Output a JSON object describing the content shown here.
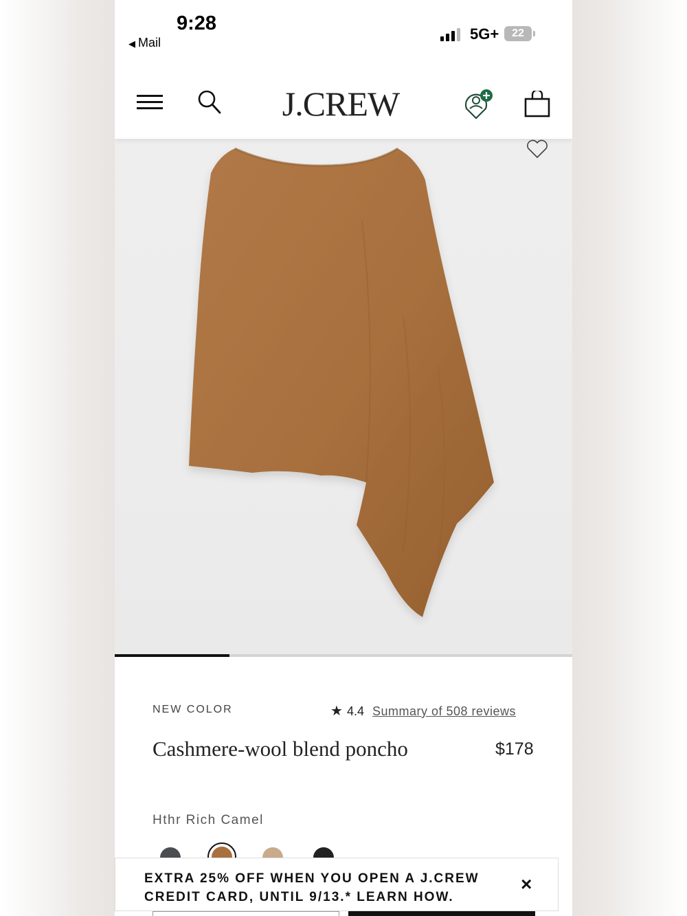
{
  "status_bar": {
    "time": "9:28",
    "back_label": "Mail",
    "network": "5G+",
    "battery": "22"
  },
  "header": {
    "logo": "J.CREW",
    "icons": [
      "menu-icon",
      "search-icon",
      "rewards-icon",
      "shopping-bag-icon"
    ]
  },
  "product": {
    "eyebrow": "NEW COLOR",
    "rating": "4.4",
    "reviews_link": "Summary of 508 reviews",
    "name": "Cashmere-wool blend poncho",
    "price": "$178",
    "selected_color": "Hthr Rich Camel",
    "image_colors": {
      "background": "#ececec",
      "garment": "#a8703e"
    },
    "carousel_progress": 0.25
  },
  "swatches": [
    {
      "color": "#4a4d52",
      "selected": false
    },
    {
      "color": "#a8703e",
      "selected": true
    },
    {
      "color": "#c8ab8c",
      "selected": false
    },
    {
      "color": "#222222",
      "selected": false
    }
  ],
  "promo": {
    "text": "EXTRA 25% OFF WHEN YOU OPEN A J.CREW CREDIT CARD, UNTIL 9/13.* LEARN HOW.",
    "close": "×"
  }
}
